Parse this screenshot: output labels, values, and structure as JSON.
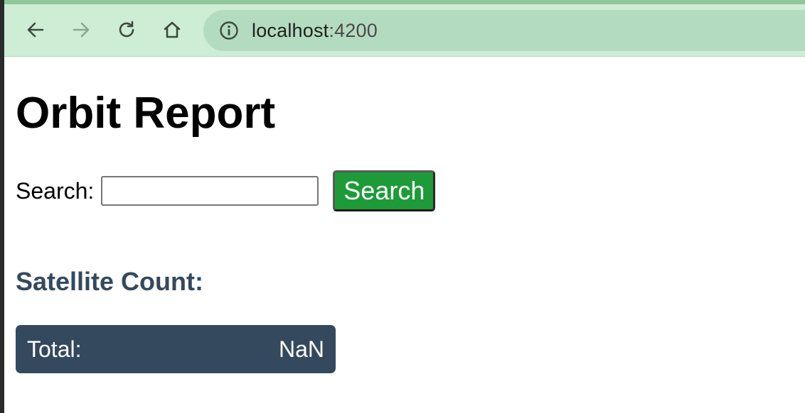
{
  "browser": {
    "url_host": "localhost",
    "url_port": ":4200",
    "toolbar_color": "#cdeed4",
    "address_bar_color": "#b3dbc0"
  },
  "page": {
    "title": "Orbit Report",
    "search": {
      "label": "Search:",
      "value": "",
      "placeholder": "",
      "button_label": "Search",
      "button_color": "#1d9b38"
    },
    "count_heading": "Satellite Count:",
    "total": {
      "label": "Total:",
      "value": "NaN",
      "box_color": "#34495e"
    }
  },
  "icons": {
    "back": "arrow-left-icon",
    "forward": "arrow-right-icon",
    "reload": "reload-icon",
    "home": "home-icon",
    "info": "info-icon"
  }
}
